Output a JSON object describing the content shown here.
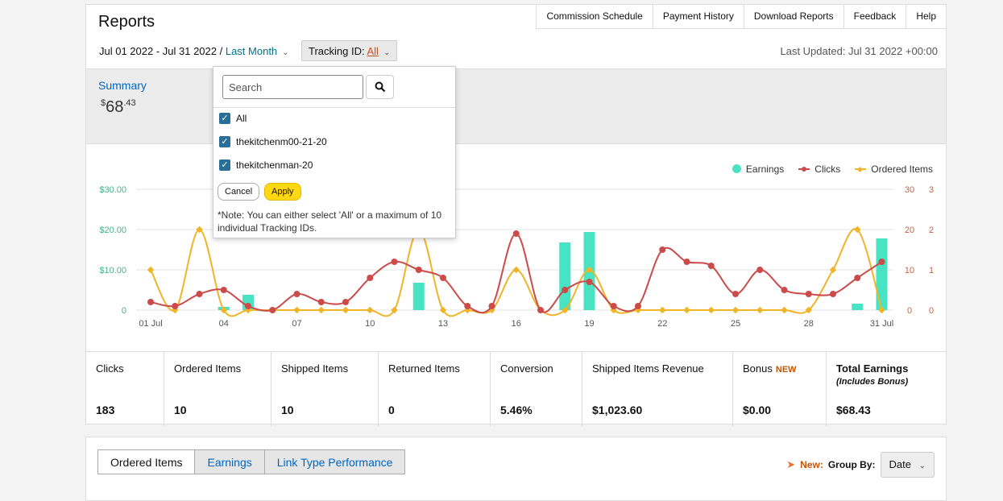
{
  "header": {
    "title": "Reports",
    "nav": [
      "Commission Schedule",
      "Payment History",
      "Download Reports",
      "Feedback",
      "Help"
    ],
    "date_range": "Jul 01 2022 - Jul 31 2022",
    "date_sep": " / ",
    "period": "Last Month",
    "tracking_label": "Tracking ID: ",
    "tracking_value": "All",
    "last_updated": "Last Updated: Jul 31 2022 +00:00"
  },
  "summary": {
    "label": "Summary",
    "currency": "$",
    "amount_main": "68",
    "amount_cents": ".43"
  },
  "dropdown": {
    "search_placeholder": "Search",
    "options": [
      "All",
      "thekitchenm00-21-20",
      "thekitchenman-20"
    ],
    "checked": [
      true,
      true,
      true
    ],
    "cancel": "Cancel",
    "apply": "Apply",
    "note": "*Note: You can either select 'All' or a maximum of 10 individual Tracking IDs."
  },
  "legend": {
    "earnings": "Earnings",
    "clicks": "Clicks",
    "ordered": "Ordered Items"
  },
  "colors": {
    "earnings": "#48e3c2",
    "clicks": "#cc4a4a",
    "ordered": "#f0b429",
    "axis_left": "#4caf8a",
    "axis_right": "#c0664a"
  },
  "chart_data": {
    "type": "line",
    "x_ticks": [
      "01 Jul",
      "04",
      "07",
      "10",
      "13",
      "16",
      "19",
      "22",
      "25",
      "28",
      "31 Jul"
    ],
    "y_left_ticks": [
      "$30.00",
      "$20.00",
      "$10.00",
      "0"
    ],
    "y_right_clicks_ticks": [
      "30",
      "20",
      "10",
      "0"
    ],
    "y_right_items_ticks": [
      "3",
      "2",
      "1",
      "0"
    ],
    "ylim_earnings": [
      0,
      30
    ],
    "ylim_clicks": [
      0,
      30
    ],
    "ylim_items": [
      0,
      3
    ],
    "days": [
      1,
      2,
      3,
      4,
      5,
      6,
      7,
      8,
      9,
      10,
      11,
      12,
      13,
      14,
      15,
      16,
      17,
      18,
      19,
      20,
      21,
      22,
      23,
      24,
      25,
      26,
      27,
      28,
      29,
      30,
      31
    ],
    "series": [
      {
        "name": "Earnings",
        "type": "bar",
        "values": [
          0,
          0,
          0,
          0.8,
          3.8,
          0,
          0,
          0,
          0,
          0,
          0,
          6.8,
          0,
          0,
          0,
          0,
          0,
          16.8,
          19.4,
          0,
          0,
          0,
          0,
          0,
          0,
          0,
          0,
          0,
          0,
          1.6,
          17.8
        ]
      },
      {
        "name": "Clicks",
        "type": "line",
        "values": [
          2,
          1,
          4,
          5,
          1,
          0,
          4,
          2,
          2,
          8,
          12,
          10,
          8,
          1,
          1,
          19,
          0,
          5,
          7,
          1,
          1,
          15,
          12,
          11,
          4,
          10,
          5,
          4,
          4,
          8,
          12
        ]
      },
      {
        "name": "Ordered Items",
        "type": "line",
        "values": [
          1,
          0,
          2,
          0,
          0,
          0,
          0,
          0,
          0,
          0,
          0,
          2,
          0,
          0,
          0,
          1,
          0,
          0,
          1,
          0,
          0,
          0,
          0,
          0,
          0,
          0,
          0,
          0,
          1,
          2,
          0
        ]
      }
    ]
  },
  "stats": [
    {
      "label": "Clicks",
      "value": "183"
    },
    {
      "label": "Ordered Items",
      "value": "10"
    },
    {
      "label": "Shipped Items",
      "value": "10"
    },
    {
      "label": "Returned Items",
      "value": "0"
    },
    {
      "label": "Conversion",
      "value": "5.46%"
    },
    {
      "label": "Shipped Items Revenue",
      "value": "$1,023.60"
    },
    {
      "label": "Bonus",
      "badge": "NEW",
      "value": "$0.00"
    },
    {
      "label": "Total Earnings",
      "sub": "(Includes Bonus)",
      "value": "$68.43"
    }
  ],
  "tabs": [
    "Ordered Items",
    "Earnings",
    "Link Type Performance"
  ],
  "groupby": {
    "new_label": "New:",
    "label": "Group By:",
    "value": "Date"
  }
}
